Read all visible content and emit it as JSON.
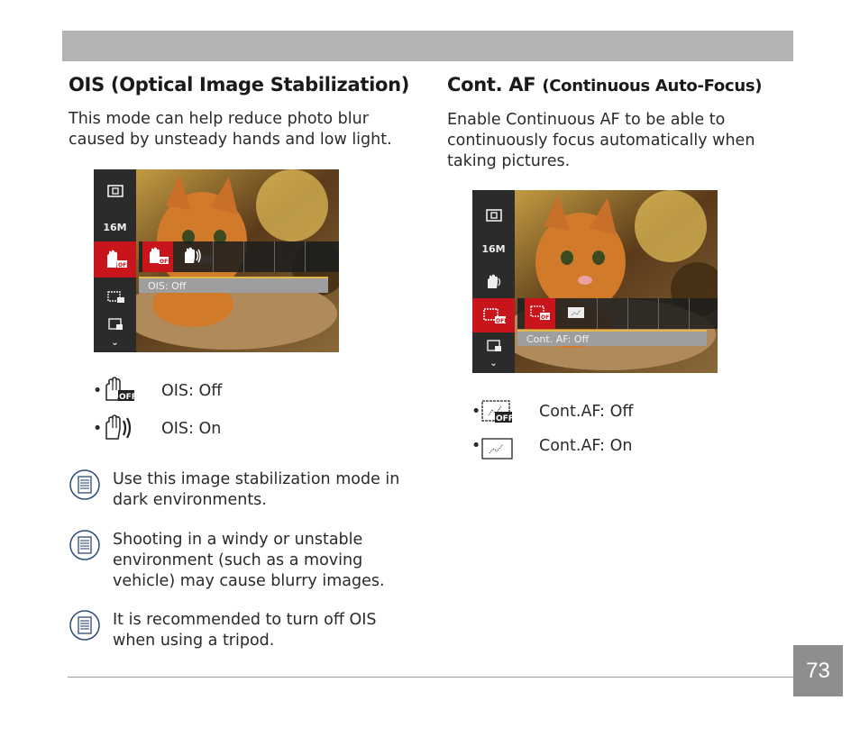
{
  "left": {
    "heading": "OIS (Optical Image Stabilization)",
    "intro": "This mode can help reduce photo blur caused by unsteady hands and low light.",
    "screen": {
      "side_items": [
        "",
        "16M",
        "",
        "",
        "",
        ""
      ],
      "label": "OIS: Off"
    },
    "bullets": [
      {
        "dot": "•",
        "text": "OIS: Off",
        "icon": "hand-ois-off-icon"
      },
      {
        "dot": "•",
        "text": "OIS: On",
        "icon": "hand-ois-on-icon"
      }
    ],
    "notes": [
      "Use this image stabilization mode in dark environments.",
      "Shooting in a windy or unstable environment (such as a moving vehicle) may cause blurry images.",
      "It is recommended to turn off OIS when using a tripod."
    ]
  },
  "right": {
    "heading_main": "Cont. AF",
    "heading_sub": "(Continuous Auto-Focus)",
    "intro": "Enable Continuous AF to be able to continuously focus automatically when taking pictures.",
    "screen": {
      "side_items": [
        "",
        "16M",
        "",
        "",
        "",
        ""
      ],
      "label": "Cont. AF: Off"
    },
    "bullets": [
      {
        "dot": "•",
        "text": "Cont.AF: Off",
        "icon": "cont-af-off-icon"
      },
      {
        "dot": "•",
        "text": "Cont.AF: On",
        "icon": "cont-af-on-icon"
      }
    ]
  },
  "page_number": "73",
  "colors": {
    "header_bar": "#b3b3b3",
    "selected_red": "#c8151b",
    "page_box": "#8e8e8e"
  }
}
